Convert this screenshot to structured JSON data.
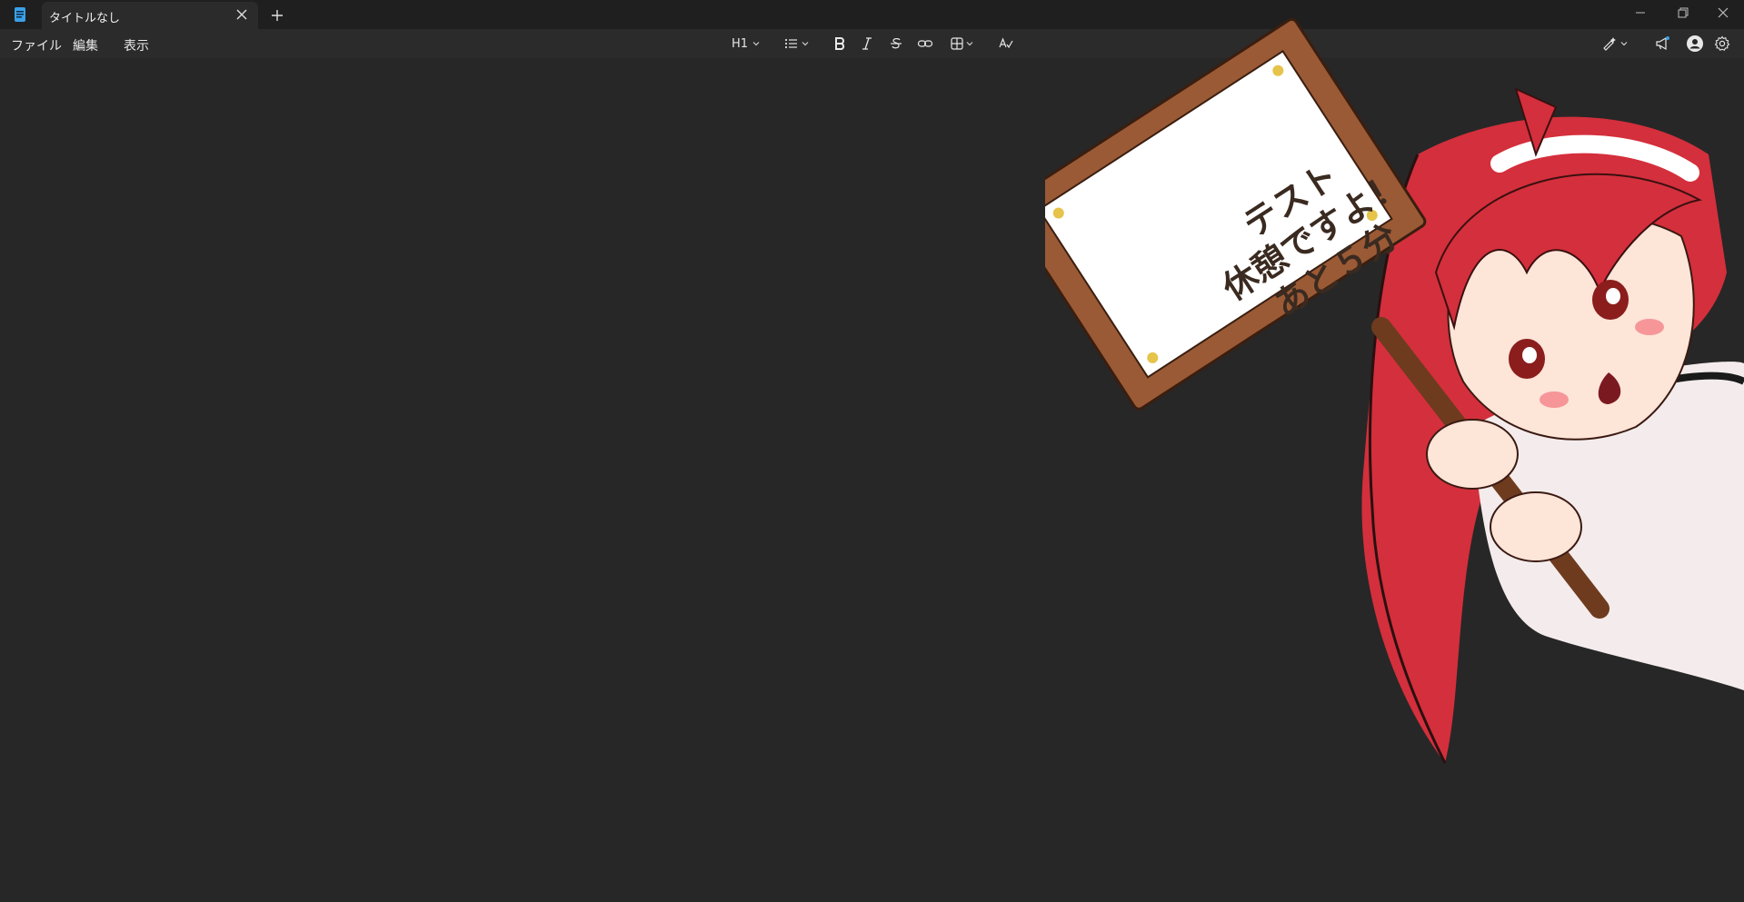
{
  "app": {
    "tab_title": "タイトルなし"
  },
  "menu": {
    "file": "ファイル",
    "edit": "編集",
    "view": "表示"
  },
  "toolbar": {
    "heading_label": "H1",
    "icons": [
      "list-icon",
      "bold-icon",
      "italic-icon",
      "strikethrough-icon",
      "link-icon",
      "table-icon",
      "spellcheck-icon",
      "pen-icon",
      "announcement-icon",
      "profile-icon",
      "settings-icon"
    ]
  },
  "illustration": {
    "sign_lines": [
      "テスト",
      "休憩ですよ！",
      "あと５分"
    ]
  }
}
